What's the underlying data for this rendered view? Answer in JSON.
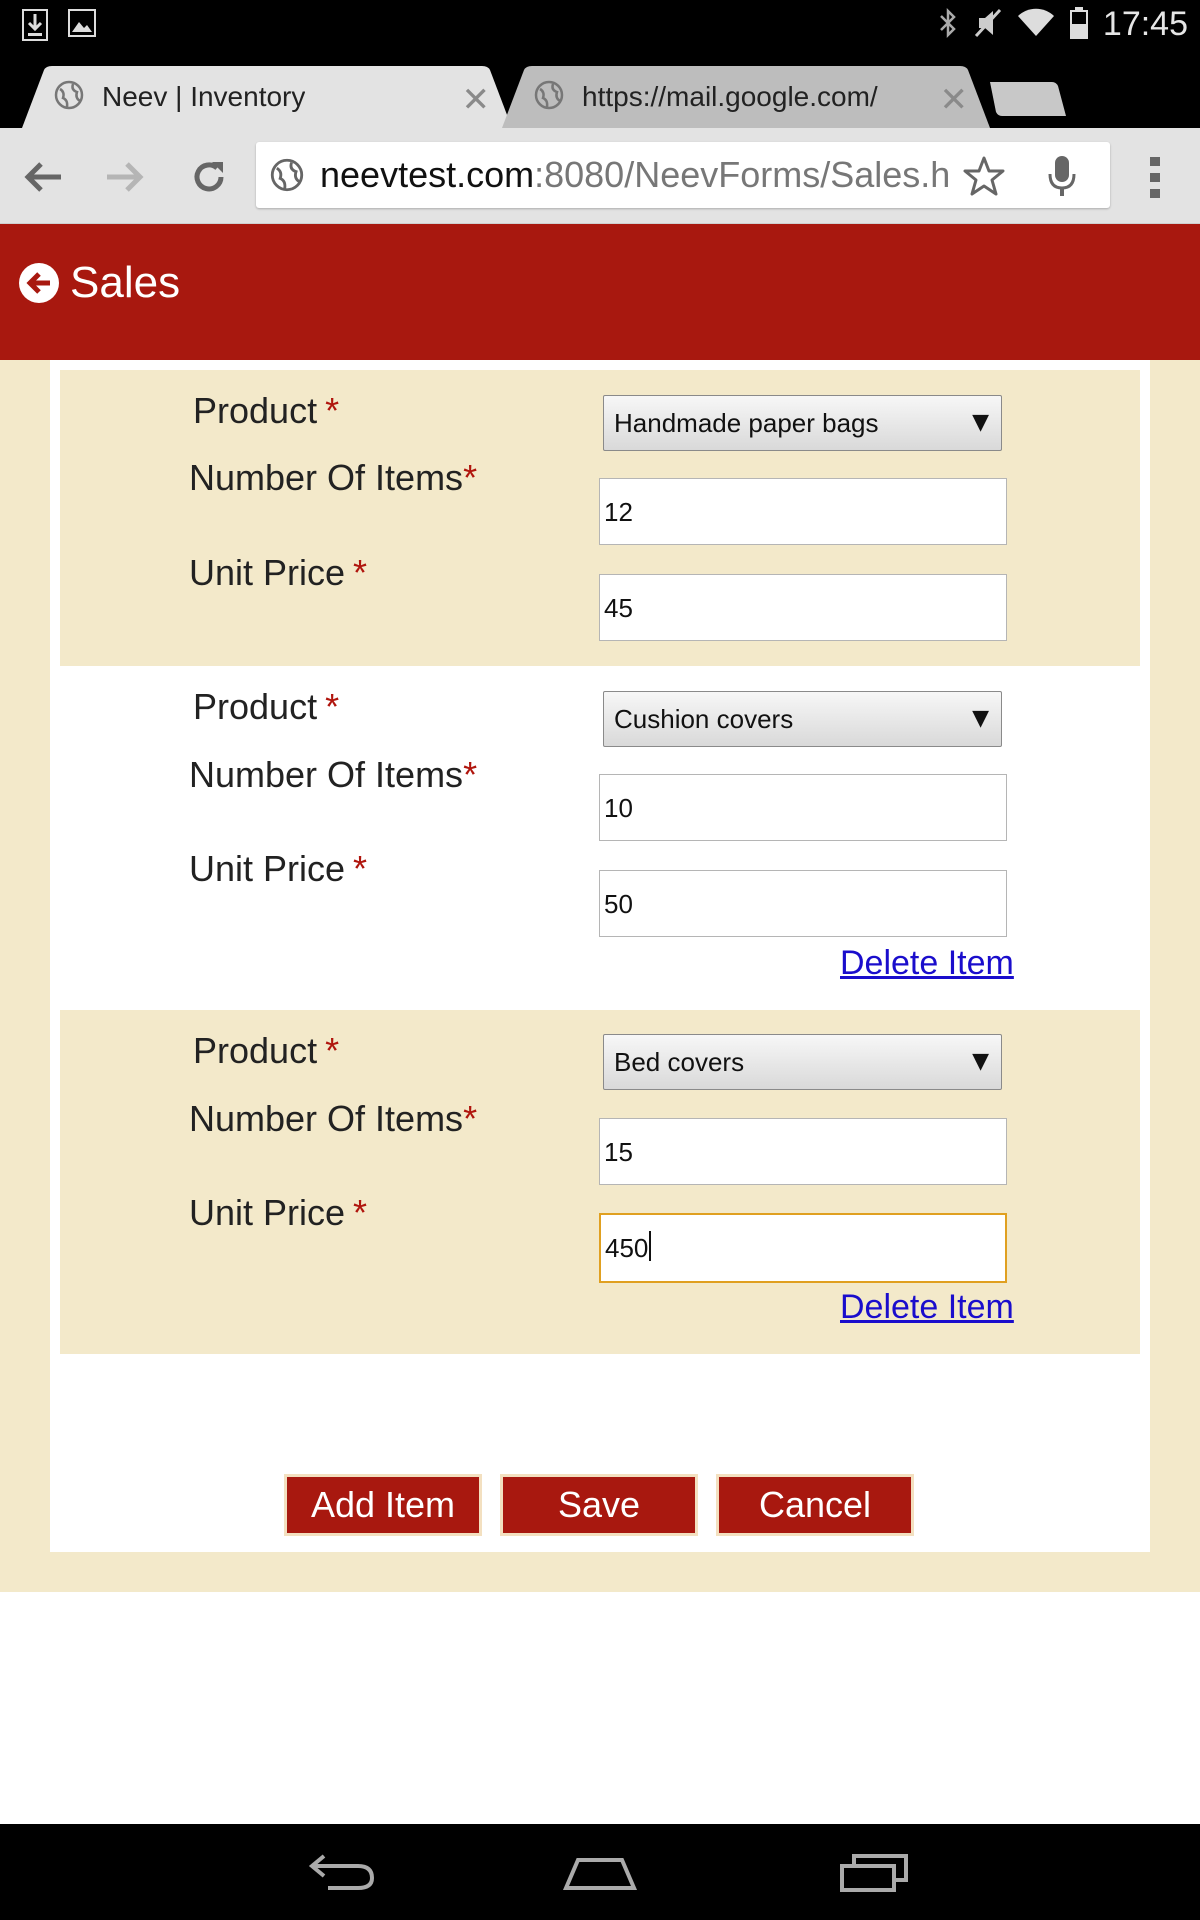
{
  "status_bar": {
    "time": "17:45",
    "left_icons": [
      "download-icon",
      "image-icon"
    ],
    "right_icons": [
      "bluetooth-icon",
      "mute-icon",
      "wifi-icon",
      "battery-icon"
    ]
  },
  "browser": {
    "tabs": [
      {
        "title": "Neev | Inventory",
        "active": true
      },
      {
        "title": "https://mail.google.com/",
        "active": false
      }
    ],
    "url_host": "neevtest.com",
    "url_path": ":8080/NeevForms/Sales.h"
  },
  "app_header": {
    "title": "Sales"
  },
  "labels": {
    "product": "Product",
    "number_of_items": "Number Of Items",
    "unit_price": "Unit Price",
    "required_mark": "*",
    "delete_item": "Delete Item"
  },
  "items": [
    {
      "product": "Handmade paper bags",
      "number_of_items": "12",
      "unit_price": "45"
    },
    {
      "product": "Cushion covers",
      "number_of_items": "10",
      "unit_price": "50"
    },
    {
      "product": "Bed covers",
      "number_of_items": "15",
      "unit_price": "450"
    }
  ],
  "actions": {
    "add_item": "Add Item",
    "save": "Save",
    "cancel": "Cancel"
  },
  "colors": {
    "header_red": "#a8180f",
    "form_tan": "#f3e9ca",
    "required_red": "#b0150d",
    "link_blue": "#1a0dcc",
    "focus_orange": "#e0a020"
  }
}
